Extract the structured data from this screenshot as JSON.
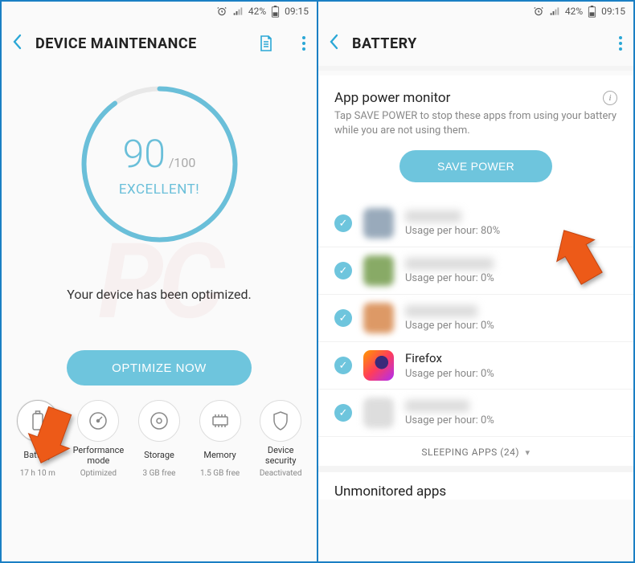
{
  "status": {
    "battery_pct": "42%",
    "time": "09:15"
  },
  "left": {
    "title": "DEVICE MAINTENANCE",
    "score": "90",
    "score_max": "/100",
    "score_label": "EXCELLENT!",
    "optimized_msg": "Your device has been optimized.",
    "optimize_btn": "OPTIMIZE NOW",
    "cats": [
      {
        "name": "Battery",
        "sub": "17 h 10 m"
      },
      {
        "name": "Performance mode",
        "sub": "Optimized"
      },
      {
        "name": "Storage",
        "sub": "3 GB free"
      },
      {
        "name": "Memory",
        "sub": "1.5 GB free"
      },
      {
        "name": "Device security",
        "sub": "Deactivated"
      }
    ]
  },
  "right": {
    "title": "BATTERY",
    "section_title": "App power monitor",
    "section_desc": "Tap SAVE POWER to stop these apps from using your battery while you are not using them.",
    "save_btn": "SAVE POWER",
    "usage_prefix": "Usage per hour: ",
    "apps": [
      {
        "name_visible": false,
        "name": "",
        "usage": "80%",
        "icon": "blur1"
      },
      {
        "name_visible": false,
        "name": "",
        "usage": "0%",
        "icon": "blur2"
      },
      {
        "name_visible": false,
        "name": "",
        "usage": "0%",
        "icon": "blur3"
      },
      {
        "name_visible": true,
        "name": "Firefox",
        "usage": "0%",
        "icon": "firefox"
      },
      {
        "name_visible": false,
        "name": "",
        "usage": "0%",
        "icon": "blur4"
      }
    ],
    "sleeping_label": "SLEEPING APPS",
    "sleeping_count": "(24)",
    "unmonitored_title": "Unmonitored apps"
  }
}
